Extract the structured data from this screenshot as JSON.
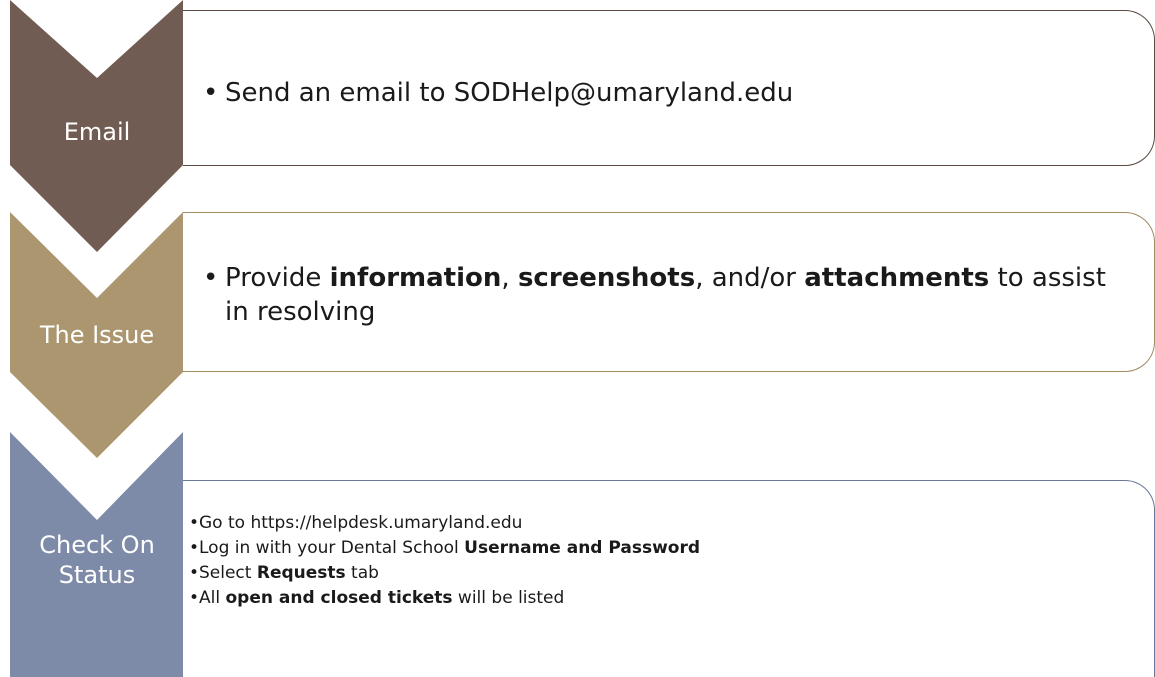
{
  "colors": {
    "step1": "#705c52",
    "step2": "#ab966f",
    "step3": "#7d8aa8",
    "border1": "#5b4a40",
    "border2": "#a08a64",
    "border3": "#6a7898"
  },
  "steps": [
    {
      "label": "Email",
      "bullets": [
        {
          "parts": [
            "Send an email to SODHelp@umaryland.edu"
          ]
        }
      ]
    },
    {
      "label": "The Issue",
      "bullets": [
        {
          "parts": [
            "Provide ",
            "information",
            ", ",
            "screenshots",
            ", and/or ",
            "attachments",
            " to assist in resolving"
          ]
        }
      ]
    },
    {
      "label_lines": [
        "Check On",
        "Status"
      ],
      "bullets": [
        {
          "parts": [
            "Go to https://helpdesk.umaryland.edu"
          ]
        },
        {
          "parts": [
            "Log in with your Dental School ",
            "Username and Password"
          ]
        },
        {
          "parts": [
            "Select ",
            "Requests",
            " tab"
          ]
        },
        {
          "parts": [
            "All ",
            "open and closed tickets",
            " will be listed"
          ]
        }
      ]
    }
  ]
}
